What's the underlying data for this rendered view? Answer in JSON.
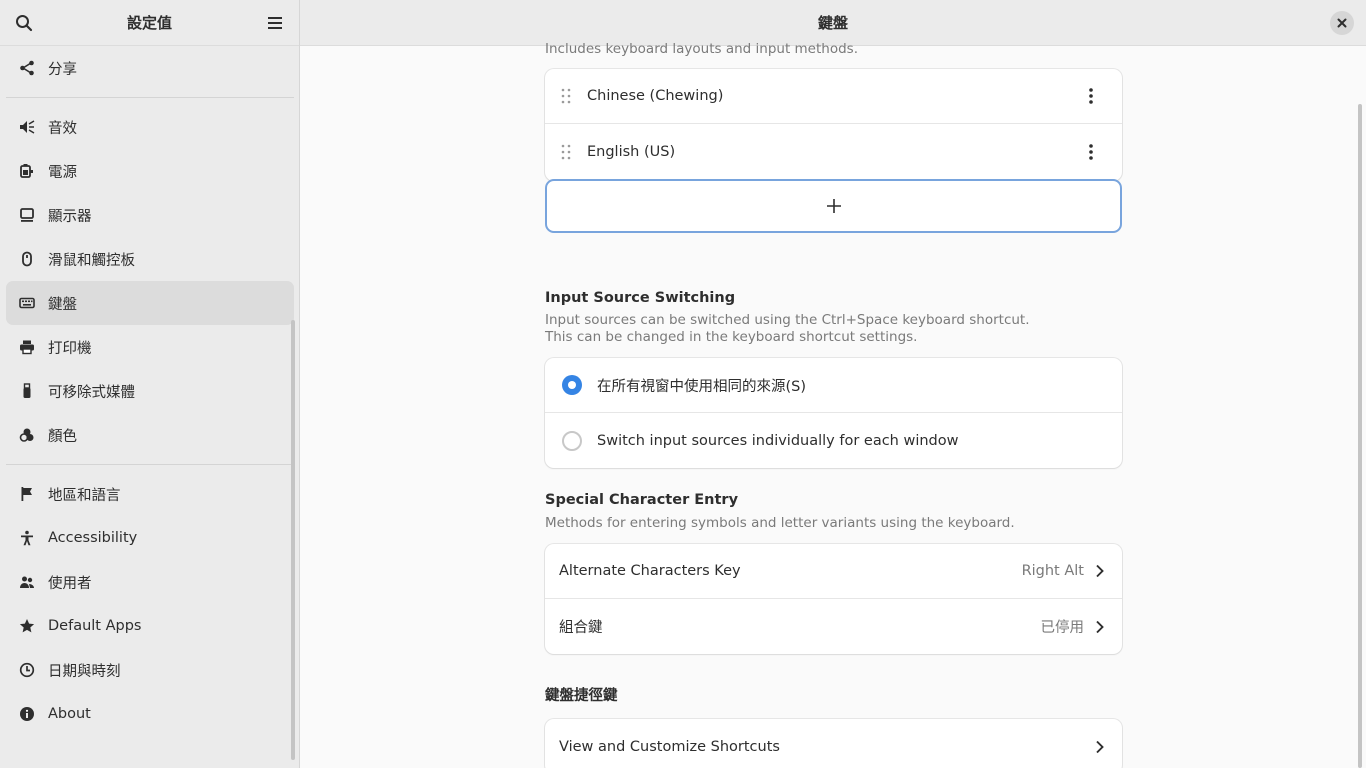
{
  "sidebar": {
    "title": "設定值",
    "items_top": [
      {
        "label": "分享",
        "icon": "share-icon"
      }
    ],
    "items_mid": [
      {
        "label": "音效",
        "icon": "speaker-icon"
      },
      {
        "label": "電源",
        "icon": "power-icon"
      },
      {
        "label": "顯示器",
        "icon": "display-icon"
      },
      {
        "label": "滑鼠和觸控板",
        "icon": "mouse-icon"
      },
      {
        "label": "鍵盤",
        "icon": "keyboard-icon",
        "active": true
      },
      {
        "label": "打印機",
        "icon": "printer-icon"
      },
      {
        "label": "可移除式媒體",
        "icon": "usb-icon"
      },
      {
        "label": "顏色",
        "icon": "color-icon"
      }
    ],
    "items_bottom": [
      {
        "label": "地區和語言",
        "icon": "flag-icon"
      },
      {
        "label": "Accessibility",
        "icon": "accessibility-icon"
      },
      {
        "label": "使用者",
        "icon": "users-icon"
      },
      {
        "label": "Default Apps",
        "icon": "star-icon"
      },
      {
        "label": "日期與時刻",
        "icon": "clock-icon"
      },
      {
        "label": "About",
        "icon": "info-icon"
      }
    ]
  },
  "main": {
    "title": "鍵盤",
    "input_sources": {
      "cut_description": "Includes keyboard layouts and input methods.",
      "items": [
        "Chinese (Chewing)",
        "English (US)"
      ],
      "add_symbol": "+"
    },
    "switching": {
      "title": "Input Source Switching",
      "desc_line1": "Input sources can be switched using the Ctrl+Space keyboard shortcut.",
      "desc_line2": "This can be changed in the keyboard shortcut settings.",
      "options": [
        {
          "label": "在所有視窗中使用相同的來源(S)",
          "selected": true
        },
        {
          "label": "Switch input sources individually for each window",
          "selected": false
        }
      ]
    },
    "special": {
      "title": "Special Character Entry",
      "desc": "Methods for entering symbols and letter variants using the keyboard.",
      "rows": [
        {
          "label": "Alternate Characters Key",
          "value": "Right Alt"
        },
        {
          "label": "組合鍵",
          "value": "已停用"
        }
      ]
    },
    "shortcuts": {
      "title": "鍵盤捷徑鍵",
      "row_label": "View and Customize Shortcuts"
    }
  },
  "colors": {
    "accent": "#3584e4",
    "focus_border": "#78a4dd"
  }
}
